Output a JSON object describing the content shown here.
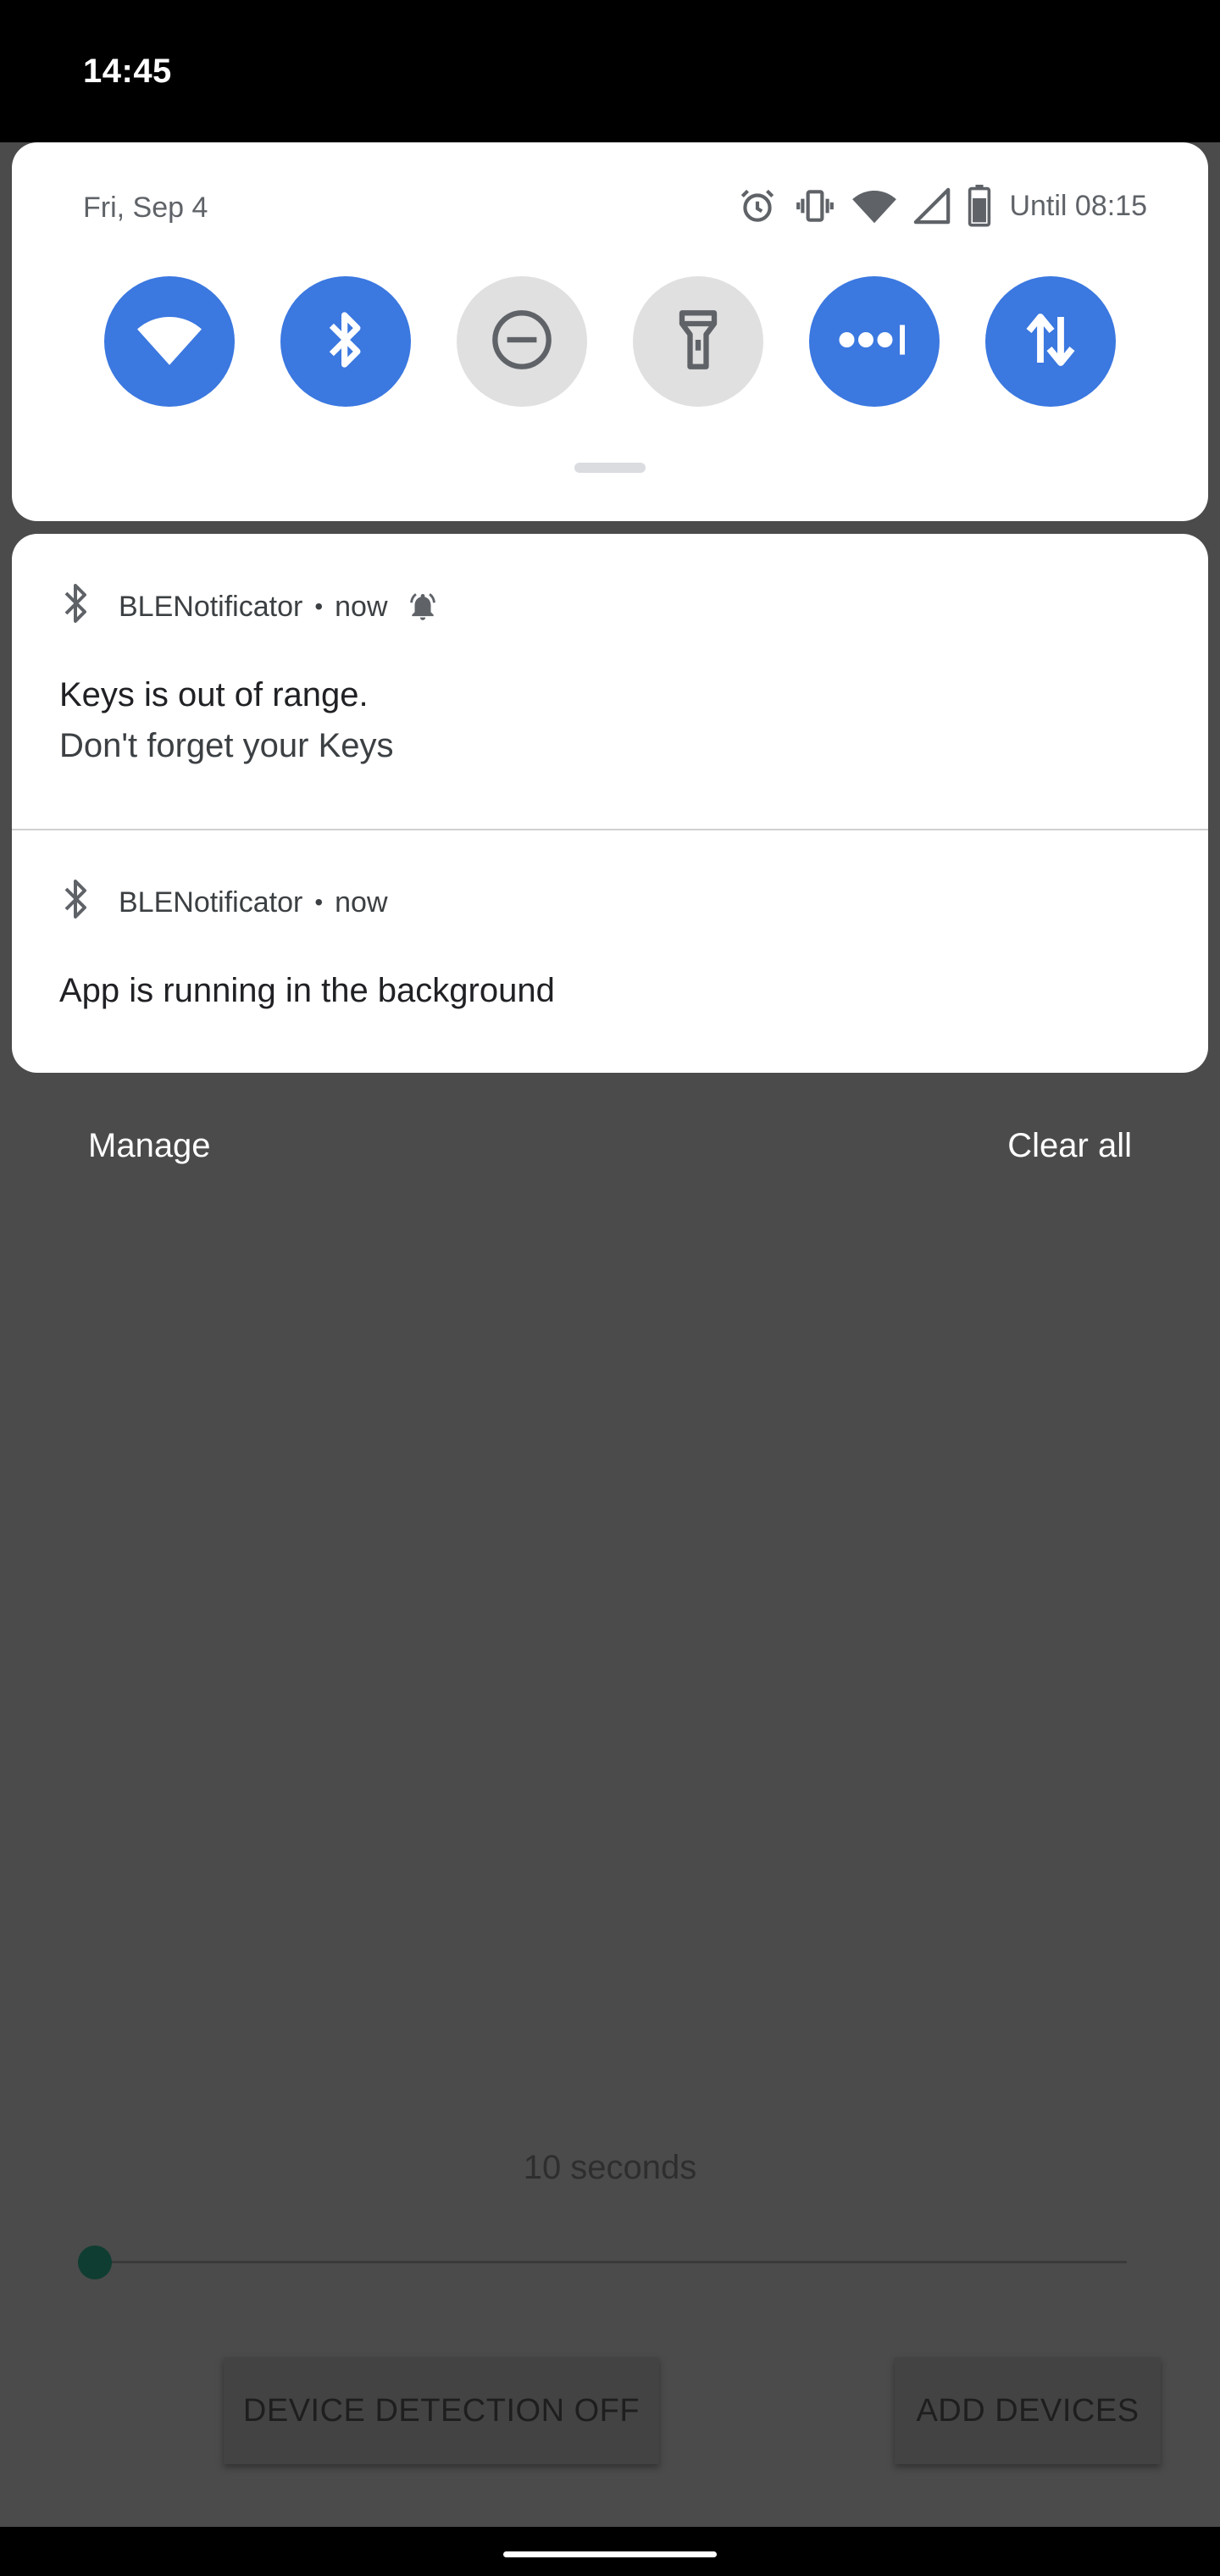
{
  "status_bar": {
    "time": "14:45"
  },
  "quick_settings": {
    "date": "Fri, Sep 4",
    "until": "Until 08:15",
    "status_icons": [
      "alarm-icon",
      "vibrate-icon",
      "wifi-signal-icon",
      "cell-signal-icon",
      "battery-icon"
    ],
    "tiles": [
      {
        "name": "wifi",
        "icon": "wifi-icon",
        "active": true
      },
      {
        "name": "bluetooth",
        "icon": "bluetooth-icon",
        "active": true
      },
      {
        "name": "do-not-disturb",
        "icon": "do-not-disturb-icon",
        "active": false
      },
      {
        "name": "flashlight",
        "icon": "flashlight-icon",
        "active": false
      },
      {
        "name": "data-saver",
        "icon": "data-saver-icon",
        "active": true
      },
      {
        "name": "mobile-data",
        "icon": "mobile-data-icon",
        "active": true
      }
    ]
  },
  "notifications": [
    {
      "app": "BLENotificator",
      "time": "now",
      "dot": "•",
      "title": "Keys is out of range.",
      "text": "Don't forget your Keys",
      "alerting": true
    },
    {
      "app": "BLENotificator",
      "time": "now",
      "dot": "•",
      "title": "App is running in the background"
    }
  ],
  "shade_actions": {
    "manage": "Manage",
    "clear_all": "Clear all"
  },
  "app": {
    "interval_label": "10 seconds",
    "slider_fraction": 0.0,
    "detect_button": "DEVICE DETECTION OFF",
    "add_button": "ADD DEVICES"
  },
  "colors": {
    "accent": "#3b78e0",
    "tile_off": "#e0e0e0",
    "scrim": "#4b4b4b",
    "panel": "#ffffff"
  }
}
